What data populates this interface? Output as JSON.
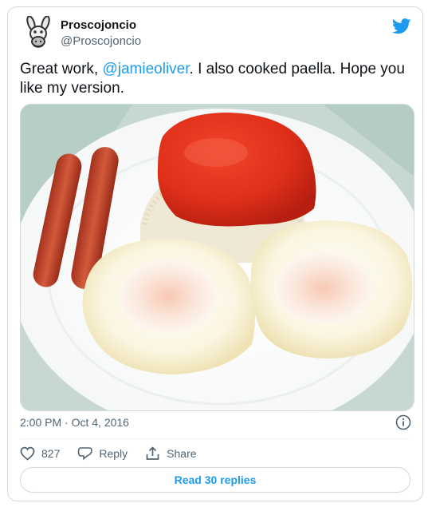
{
  "author": {
    "name": "Proscojoncio",
    "handle": "@Proscojoncio"
  },
  "tweet": {
    "text_before": "Great work, ",
    "mention": "@jamieoliver",
    "text_after": ". I also cooked paella. Hope you like my version."
  },
  "meta": {
    "timestamp": "2:00 PM · Oct 4, 2016"
  },
  "actions": {
    "like_count": "827",
    "reply_label": "Reply",
    "share_label": "Share"
  },
  "replies_button": "Read 30 replies",
  "icons": {
    "platform": "bird-icon",
    "like": "heart-icon",
    "reply": "speech-bubble-icon",
    "share": "share-icon",
    "info": "info-icon"
  },
  "colors": {
    "accent": "#1d9bf0",
    "text": "#0f1419",
    "secondary_text": "#536471",
    "border": "#cfd9de"
  }
}
